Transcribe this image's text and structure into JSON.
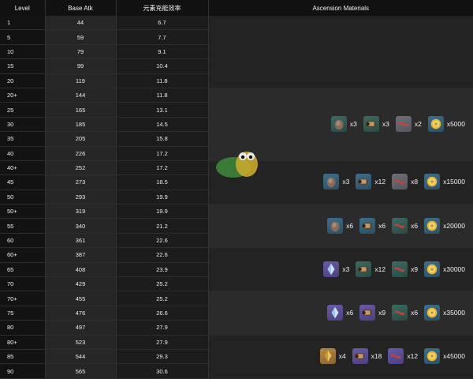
{
  "headers": {
    "level": "Level",
    "base_atk": "Base Atk",
    "energy_recharge": "元素充能效率",
    "ascension": "Ascension Materials"
  },
  "rows": [
    {
      "level": "1",
      "atk": "44",
      "er": "6.7"
    },
    {
      "level": "5",
      "atk": "59",
      "er": "7.7"
    },
    {
      "level": "10",
      "atk": "79",
      "er": "9.1"
    },
    {
      "level": "15",
      "atk": "99",
      "er": "10.4"
    },
    {
      "level": "20",
      "atk": "119",
      "er": "11.8"
    },
    {
      "level": "20+",
      "atk": "144",
      "er": "11.8"
    },
    {
      "level": "25",
      "atk": "165",
      "er": "13.1"
    },
    {
      "level": "30",
      "atk": "185",
      "er": "14.5"
    },
    {
      "level": "35",
      "atk": "205",
      "er": "15.8"
    },
    {
      "level": "40",
      "atk": "226",
      "er": "17.2"
    },
    {
      "level": "40+",
      "atk": "252",
      "er": "17.2"
    },
    {
      "level": "45",
      "atk": "273",
      "er": "18.5"
    },
    {
      "level": "50",
      "atk": "293",
      "er": "19.9"
    },
    {
      "level": "50+",
      "atk": "319",
      "er": "19.9"
    },
    {
      "level": "55",
      "atk": "340",
      "er": "21.2"
    },
    {
      "level": "60",
      "atk": "361",
      "er": "22.6"
    },
    {
      "level": "60+",
      "atk": "387",
      "er": "22.6"
    },
    {
      "level": "65",
      "atk": "408",
      "er": "23.9"
    },
    {
      "level": "70",
      "atk": "429",
      "er": "25.2"
    },
    {
      "level": "70+",
      "atk": "455",
      "er": "25.2"
    },
    {
      "level": "75",
      "atk": "476",
      "er": "26.6"
    },
    {
      "level": "80",
      "atk": "497",
      "er": "27.9"
    },
    {
      "level": "80+",
      "atk": "523",
      "er": "27.9"
    },
    {
      "level": "85",
      "atk": "544",
      "er": "29.3"
    },
    {
      "level": "90",
      "atk": "565",
      "er": "30.6"
    }
  ],
  "ascension": [
    {
      "rows": 5,
      "materials": []
    },
    {
      "rows": 5,
      "materials": [
        {
          "icon": "chunk-icon",
          "tier": "t3",
          "count": "x3"
        },
        {
          "icon": "scroll-icon",
          "tier": "t3",
          "count": "x3"
        },
        {
          "icon": "ribbon-icon",
          "tier": "t1",
          "count": "x2"
        },
        {
          "icon": "mora-coin-icon",
          "tier": "t2",
          "count": "x5000"
        }
      ]
    },
    {
      "rows": 3,
      "materials": [
        {
          "icon": "chunk-icon",
          "tier": "t2",
          "count": "x3"
        },
        {
          "icon": "scroll-icon",
          "tier": "t2",
          "count": "x12"
        },
        {
          "icon": "ribbon-icon",
          "tier": "t1",
          "count": "x8"
        },
        {
          "icon": "mora-coin-icon",
          "tier": "t2",
          "count": "x15000"
        }
      ]
    },
    {
      "rows": 3,
      "materials": [
        {
          "icon": "chunk-icon",
          "tier": "t2",
          "count": "x6"
        },
        {
          "icon": "scroll-icon",
          "tier": "t2",
          "count": "x6"
        },
        {
          "icon": "ribbon-icon",
          "tier": "t3",
          "count": "x6"
        },
        {
          "icon": "mora-coin-icon",
          "tier": "t2",
          "count": "x20000"
        }
      ]
    },
    {
      "rows": 3,
      "materials": [
        {
          "icon": "crystal-icon",
          "tier": "t4",
          "count": "x3"
        },
        {
          "icon": "scroll-icon",
          "tier": "t3",
          "count": "x12"
        },
        {
          "icon": "ribbon-icon",
          "tier": "t3",
          "count": "x9"
        },
        {
          "icon": "mora-coin-icon",
          "tier": "t2",
          "count": "x30000"
        }
      ]
    },
    {
      "rows": 3,
      "materials": [
        {
          "icon": "crystal-icon",
          "tier": "t4",
          "count": "x6"
        },
        {
          "icon": "scroll-icon",
          "tier": "t4",
          "count": "x9"
        },
        {
          "icon": "ribbon-icon",
          "tier": "t3",
          "count": "x6"
        },
        {
          "icon": "mora-coin-icon",
          "tier": "t2",
          "count": "x35000"
        }
      ]
    },
    {
      "rows": 3,
      "materials": [
        {
          "icon": "gem-icon",
          "tier": "t5",
          "count": "x4"
        },
        {
          "icon": "scroll-icon",
          "tier": "t4",
          "count": "x18"
        },
        {
          "icon": "ribbon-icon",
          "tier": "t4",
          "count": "x12"
        },
        {
          "icon": "mora-coin-icon",
          "tier": "t2",
          "count": "x45000"
        }
      ]
    }
  ],
  "watermark": {
    "icon": "site-logo-icon"
  }
}
